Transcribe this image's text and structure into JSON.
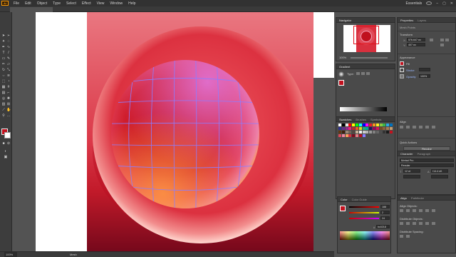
{
  "app": {
    "logo": "Ai"
  },
  "menubar": {
    "items": [
      "File",
      "Edit",
      "Object",
      "Type",
      "Select",
      "Effect",
      "View",
      "Window",
      "Help"
    ],
    "workspace": "Essentials"
  },
  "tab": {
    "title": ""
  },
  "statusbar": {
    "zoom": "100%",
    "tool": "Mesh"
  },
  "navigator": {
    "title": "Navigator",
    "zoom": "100%"
  },
  "gradient": {
    "title": "Gradient",
    "type_label": "Type:"
  },
  "swatches": {
    "tabs": [
      "Swatches",
      "Brushes",
      "Symbols"
    ]
  },
  "color": {
    "tabs": [
      "Color",
      "Color Guide"
    ],
    "hex": "bc0218",
    "values": [
      "188",
      "2",
      "24"
    ]
  },
  "properties": {
    "tabs": [
      "Properties",
      "Layers"
    ],
    "selection": "Mesh Points",
    "transform_label": "Transform",
    "x": "576.647 px",
    "y": "407 px",
    "appearance_label": "Appearance",
    "fill_label": "Fill",
    "stroke_label": "Stroke",
    "opacity_label": "Opacity",
    "opacity": "100%",
    "align_label": "Align",
    "quick_actions_label": "Quick Actions",
    "quick_button": "Recolor"
  },
  "character": {
    "tabs": [
      "Character",
      "Paragraph"
    ],
    "font": "Myriad Pro",
    "style": "Regular",
    "size": "12 pt",
    "leading": "(14.4 pt)"
  },
  "align_panel": {
    "tabs": [
      "Align",
      "Pathfinder"
    ],
    "align_objects": "Align Objects:",
    "distribute_objects": "Distribute Objects:",
    "distribute_spacing": "Distribute Spacing:"
  },
  "artwork": {
    "background_top": "#e9707a",
    "background_bottom": "#7d0a1d",
    "outer_sphere": "#e0404c",
    "inner_sphere": "#c0101e",
    "mesh_color": "#8a7cff",
    "accent": "#c1121f"
  }
}
